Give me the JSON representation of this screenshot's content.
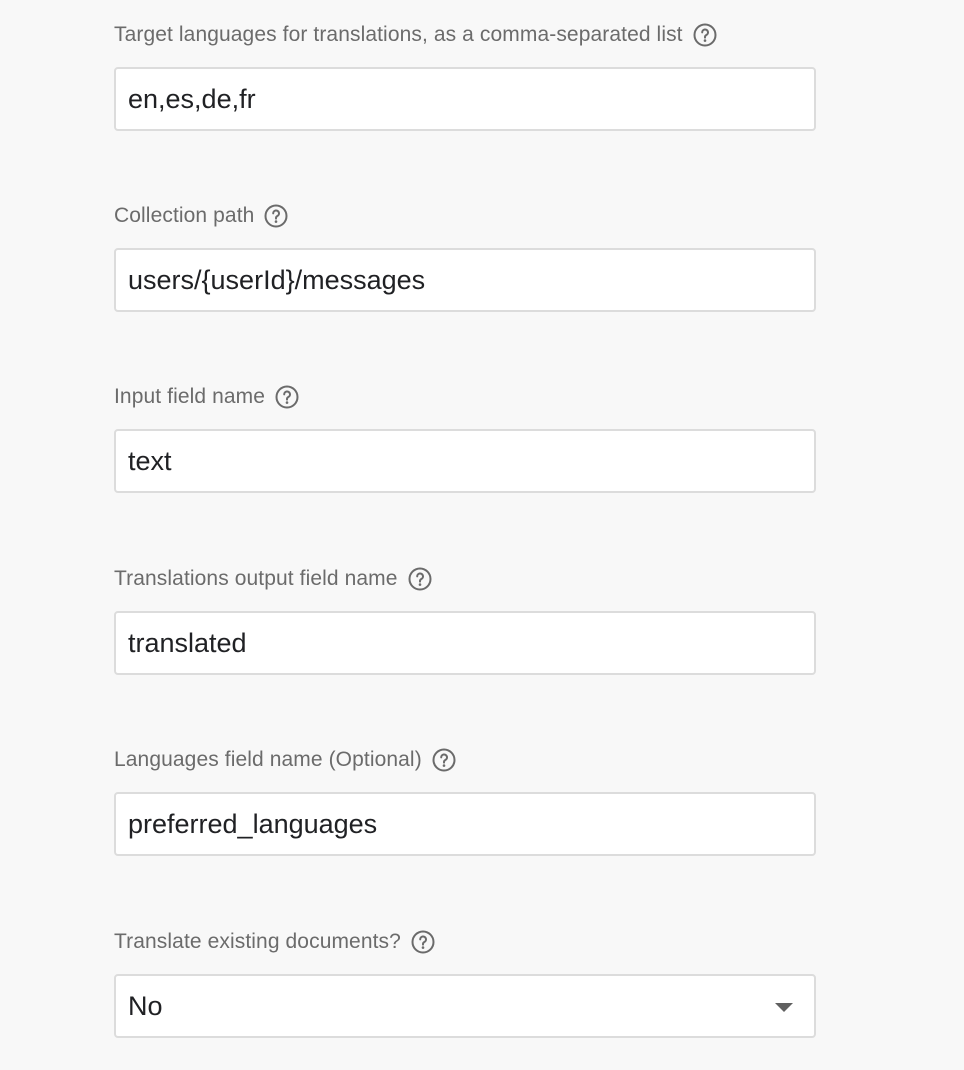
{
  "fields": [
    {
      "label": "Target languages for translations, as a comma-separated list",
      "value": "en,es,de,fr",
      "help_icon": "question-circle-icon"
    },
    {
      "label": "Collection path",
      "value": "users/{userId}/messages",
      "help_icon": "question-circle-icon"
    },
    {
      "label": "Input field name",
      "value": "text",
      "help_icon": "question-circle-icon"
    },
    {
      "label": "Translations output field name",
      "value": "translated",
      "help_icon": "question-circle-icon"
    },
    {
      "label": "Languages field name (Optional)",
      "value": "preferred_languages",
      "help_icon": "question-circle-icon"
    }
  ],
  "select_field": {
    "label": "Translate existing documents?",
    "selected": "No",
    "help_icon": "question-circle-icon",
    "arrow_icon": "dropdown-arrow-icon"
  },
  "colors": {
    "background": "#f8f8f8",
    "label": "#6b6b6b",
    "input_border": "#dcdcdc",
    "input_text": "#202124"
  }
}
